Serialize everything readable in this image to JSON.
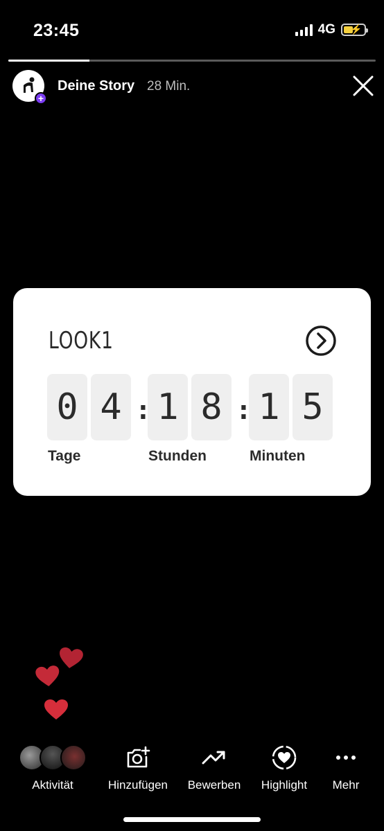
{
  "status_bar": {
    "time": "23:45",
    "network": "4G",
    "battery_percent": 45
  },
  "story": {
    "progress_fraction": 0.22,
    "title": "Deine Story",
    "elapsed": "28 Min."
  },
  "countdown": {
    "title": "LOOK1",
    "digits": [
      "0",
      "4",
      "1",
      "8",
      "1",
      "5"
    ],
    "colon": ":",
    "units": {
      "days": "Tage",
      "hours": "Stunden",
      "minutes": "Minuten"
    }
  },
  "colors": {
    "accent_plus": "#7b3cf2",
    "heart": "#d62e3b",
    "heart_dark": "#b32433",
    "battery": "#f4d03f"
  },
  "bottom_bar": {
    "activity": "Aktivität",
    "add": "Hinzufügen",
    "promote": "Bewerben",
    "highlight": "Highlight",
    "more": "Mehr"
  },
  "icons": [
    "signal-icon",
    "battery-icon",
    "close-icon",
    "arrow-circle-icon",
    "heart-icon",
    "camera-plus-icon",
    "trend-up-icon",
    "highlight-heart-icon",
    "more-dots-icon"
  ]
}
